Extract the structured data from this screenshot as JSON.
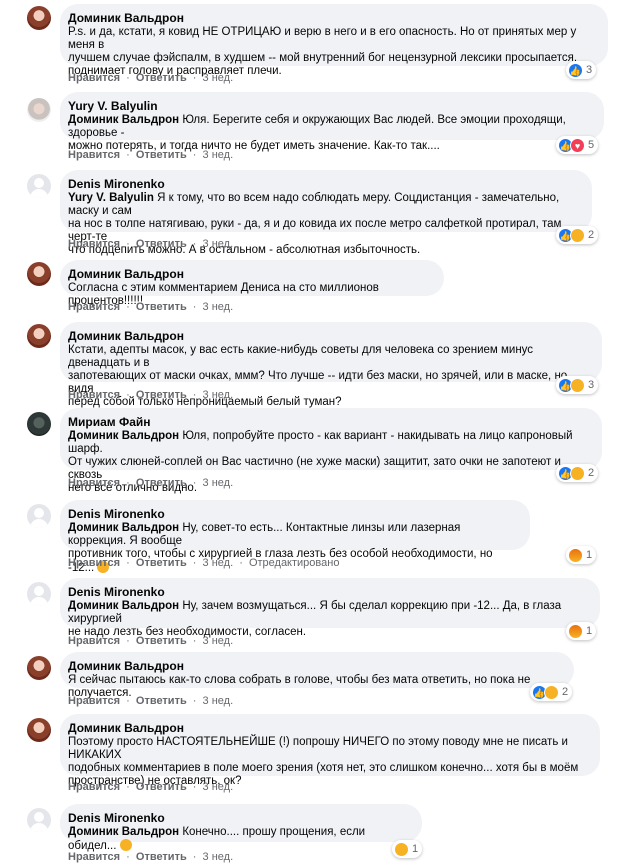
{
  "actions": {
    "like": "Нравится",
    "reply": "Ответить",
    "dot": "·",
    "edited": "Отредактировано"
  },
  "comments": [
    {
      "author": "Доминик Вальдрон",
      "tag": "",
      "lines": [
        "P.s. и да, кстати, я ковид НЕ ОТРИЦАЮ и верю в него и в его опасность. Но от принятых мер у меня в",
        "лучшем случае фэйспалм, в худшем -- мой внутренний бог нецензурной лексики просыпается,",
        "поднимает голову и расправляет плечи."
      ],
      "time": "3 нед.",
      "reactions": [
        "like-icon"
      ],
      "count": "3"
    },
    {
      "author": "Yury V. Balyulin",
      "tag": "Доминик Вальдрон",
      "lines": [
        " Юля. Берегите себя и окружающих Вас людей. Все эмоции проходящи, здоровье -",
        "можно потерять, и тогда ничто не будет иметь значение. Как-то так...."
      ],
      "time": "3 нед.",
      "reactions": [
        "like-icon",
        "love-icon"
      ],
      "count": "5"
    },
    {
      "author": "Denis Mironenko",
      "tag": "Yury V. Balyulin",
      "lines": [
        " Я к тому, что во всем надо соблюдать меру. Соцдистанция - замечательно, маску и сам",
        "на нос в толпе натягиваю, руки - да, я и до ковида их после метро салфеткой протирал, там черт-те",
        "что подцепить можно. А в остальном - абсолютная избыточность."
      ],
      "time": "3 нед.",
      "reactions": [
        "like-icon",
        "haha-icon"
      ],
      "count": "2"
    },
    {
      "author": "Доминик Вальдрон",
      "tag": "",
      "lines": [
        "Согласна с этим комментарием Дениса на сто миллионов процентов!!!!!!"
      ],
      "time": "3 нед.",
      "reactions": [],
      "count": ""
    },
    {
      "author": "Доминик Вальдрон",
      "tag": "",
      "lines": [
        "Кстати, адепты масок, у вас есть какие-нибудь советы для человека со зрением минус двенадцать и в",
        "запотевающих от маски очках, ммм? Что лучше -- идти без маски, но зрячей, или в маске, но видя",
        "перед собой только непроницаемый белый туман?"
      ],
      "time": "3 нед.",
      "reactions": [
        "like-icon",
        "haha-icon"
      ],
      "count": "3"
    },
    {
      "author": "Мириам Файн",
      "tag": "Доминик Вальдрон",
      "lines": [
        " Юля, попробуйте просто - как вариант - накидывать на лицо капроновый шарф.",
        "От чужих слюней-соплей он Вас частично (не хуже маски) защитит, зато очки не запотеют и сквозь",
        "него всё отлично видно."
      ],
      "time": "3 нед.",
      "reactions": [
        "like-icon",
        "wow-icon"
      ],
      "count": "2"
    },
    {
      "author": "Denis Mironenko",
      "tag": "Доминик Вальдрон",
      "lines": [
        " Ну, совет-то есть... Контактные линзы или лазерная коррекция. Я вообще",
        "противник того, чтобы с хирургией в глаза лезть без особой необходимости, но -12..."
      ],
      "time": "3 нед.",
      "edited": true,
      "reactions": [
        "angry-icon"
      ],
      "count": "1"
    },
    {
      "author": "Denis Mironenko",
      "tag": "Доминик Вальдрон",
      "lines": [
        " Ну, зачем возмущаться... Я бы сделал коррекцию при -12... Да, в глаза хирургией",
        "не надо лезть без необходимости, согласен."
      ],
      "time": "3 нед.",
      "reactions": [
        "angry-icon"
      ],
      "count": "1"
    },
    {
      "author": "Доминик Вальдрон",
      "tag": "",
      "lines": [
        "Я сейчас пытаюсь как-то слова собрать в голове, чтобы без мата ответить, но пока не получается."
      ],
      "time": "3 нед.",
      "reactions": [
        "like-icon",
        "sad-icon"
      ],
      "count": "2"
    },
    {
      "author": "Доминик Вальдрон",
      "tag": "",
      "lines": [
        "Поэтому просто НАСТОЯТЕЛЬНЕЙШЕ (!) попрошу НИЧЕГО по этому поводу мне не писать и НИКАКИХ",
        "подобных комментариев в поле моего зрения (хотя нет, это слишком конечно... хотя бы в моём",
        "пространстве) не оставлять, ок?"
      ],
      "time": "3 нед.",
      "reactions": [],
      "count": ""
    },
    {
      "author": "Denis Mironenko",
      "tag": "Доминик Вальдрон",
      "lines": [
        " Конечно.... прошу прощения, если обидел..."
      ],
      "time": "3 нед.",
      "reactions": [
        "sad-icon"
      ],
      "count": "1"
    }
  ]
}
